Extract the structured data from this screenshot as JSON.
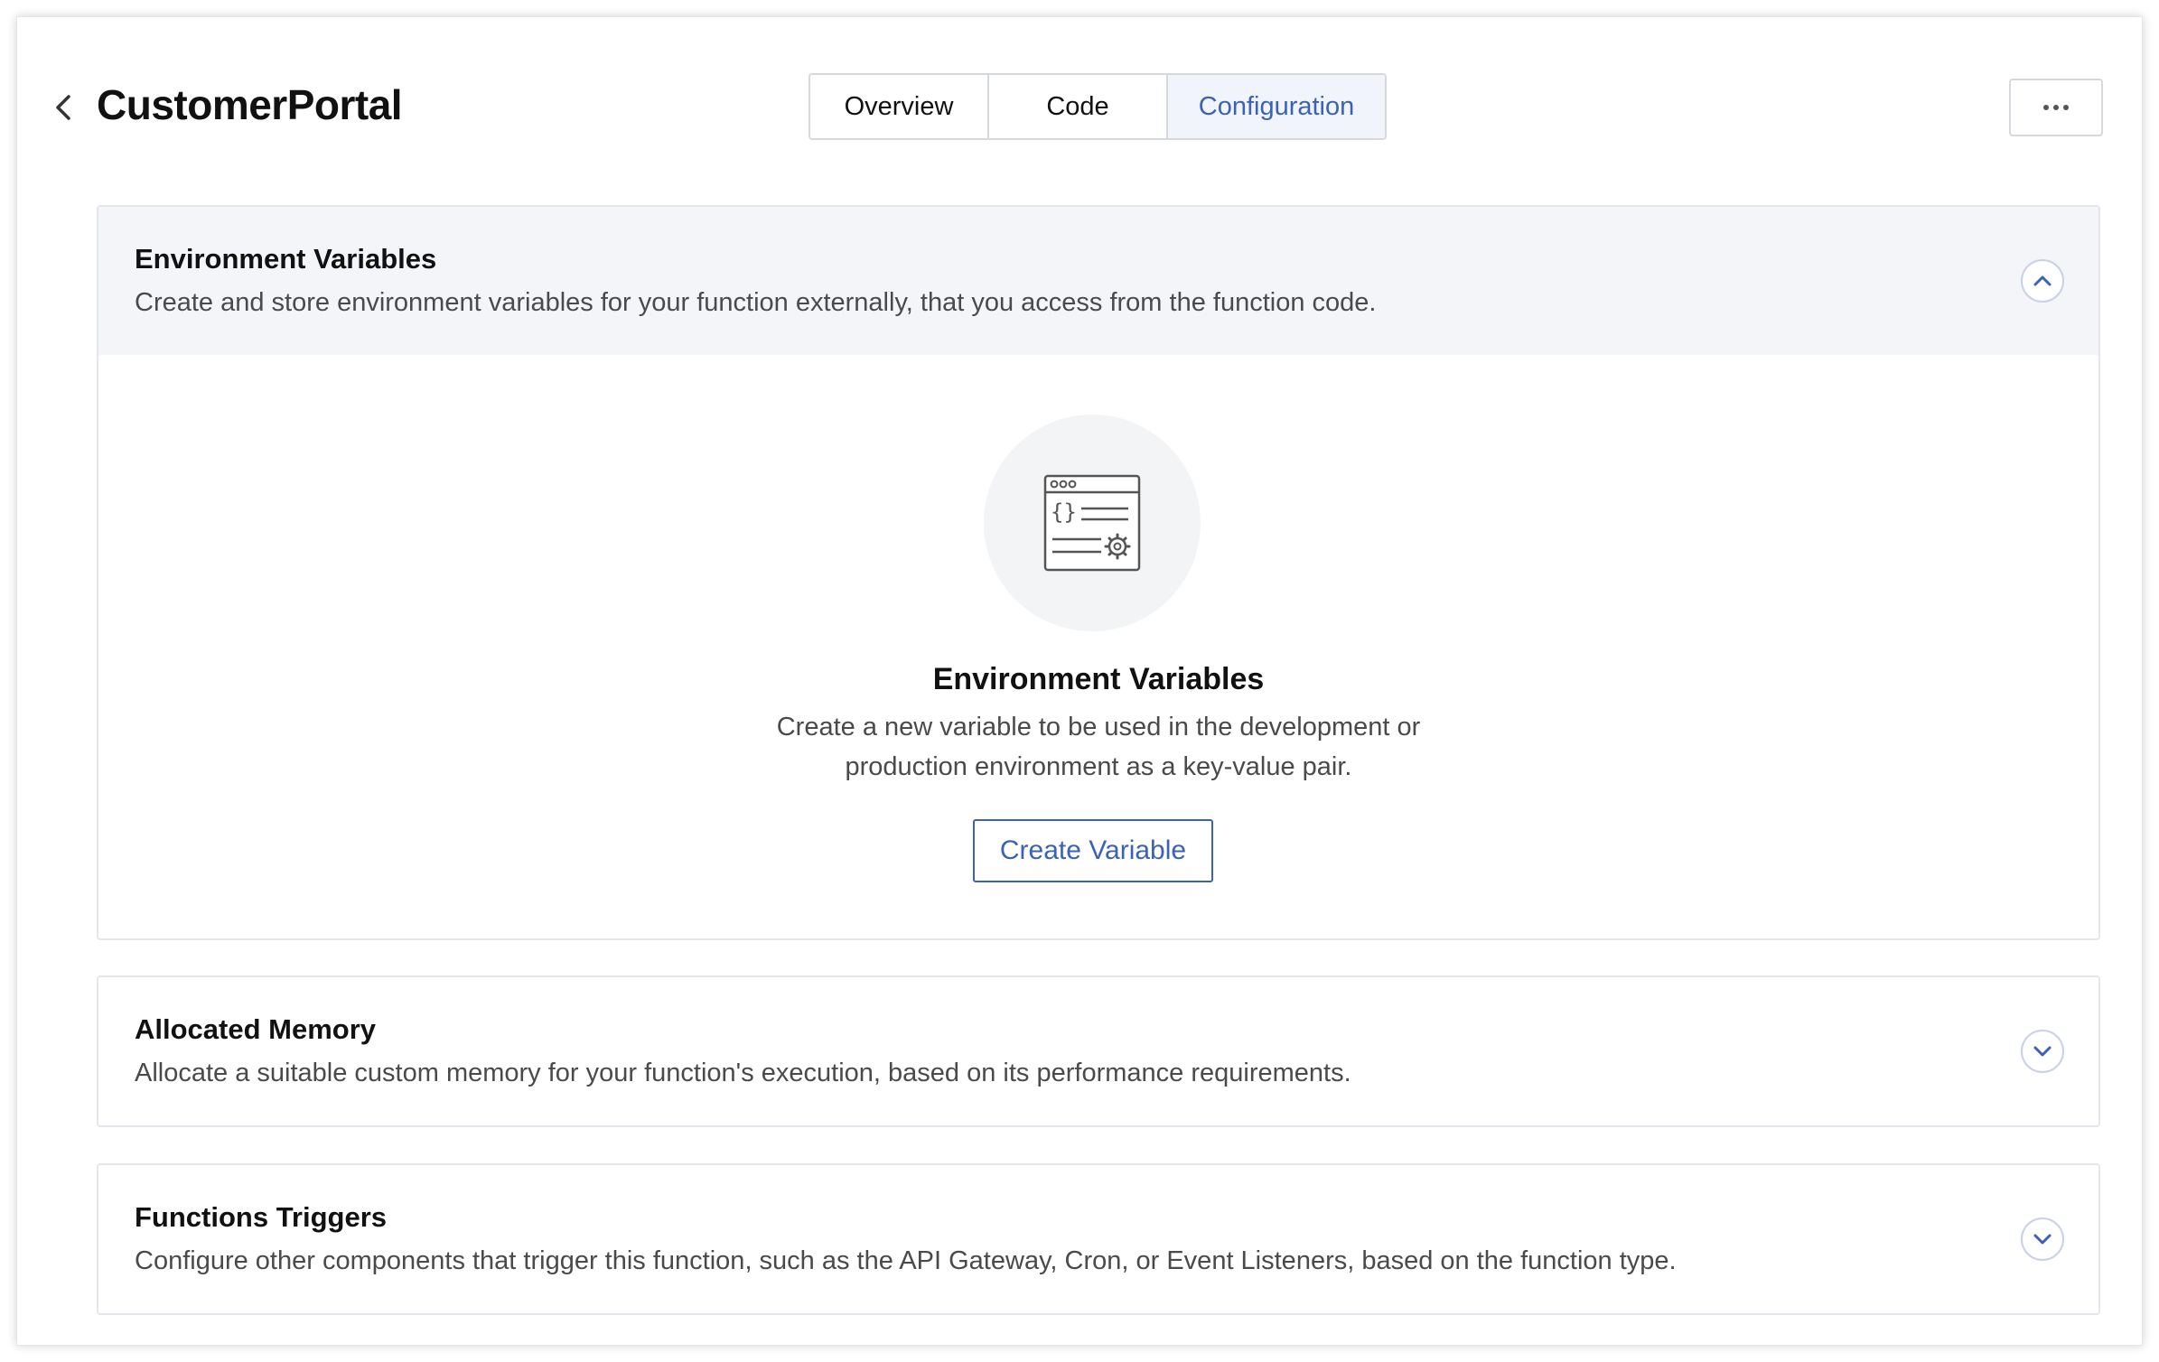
{
  "header": {
    "title": "CustomerPortal",
    "tabs": [
      "Overview",
      "Code",
      "Configuration"
    ],
    "active_tab": "Configuration",
    "back_icon": "chevron-left-icon",
    "more_icon": "more-horizontal-icon"
  },
  "sections": [
    {
      "title": "Environment Variables",
      "description": "Create and store environment variables for your function externally, that you access from the function code.",
      "expanded": true,
      "empty_state": {
        "icon": "code-window-settings-icon",
        "title": "Environment Variables",
        "description_line1": "Create a new variable to be used in the development or",
        "description_line2": "production environment as a key-value pair.",
        "button_label": "Create Variable"
      }
    },
    {
      "title": "Allocated Memory",
      "description": "Allocate a suitable custom memory for your function's execution, based on its performance requirements.",
      "expanded": false
    },
    {
      "title": "Functions Triggers",
      "description": "Configure other components that trigger this function, such as the API Gateway, Cron, or Event Listeners, based on the function type.",
      "expanded": false
    }
  ],
  "colors": {
    "accent": "#3a63b7",
    "header_bg": "#f3f5f9",
    "border": "#e3e6ea"
  }
}
